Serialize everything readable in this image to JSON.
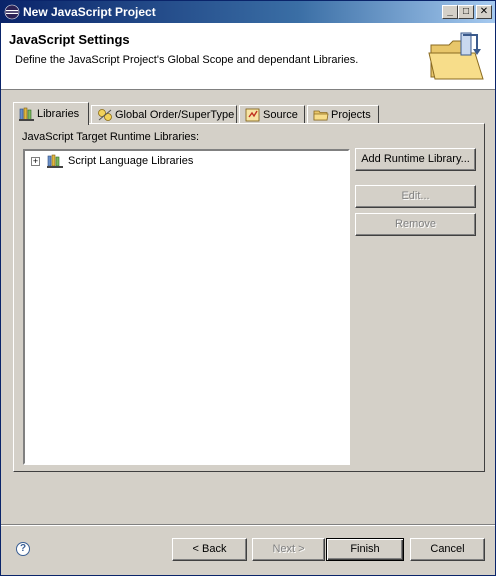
{
  "window": {
    "title": "New JavaScript Project",
    "controls": {
      "minimize": "_",
      "maximize": "□",
      "close": "✕"
    }
  },
  "banner": {
    "title": "JavaScript Settings",
    "description": "Define the JavaScript Project's Global Scope and dependant Libraries.",
    "icon": "wizard-folder-icon"
  },
  "tabs": [
    {
      "label": "Libraries",
      "icon": "libraries-icon",
      "active": true
    },
    {
      "label": "Global Order/SuperType",
      "icon": "order-icon",
      "active": false
    },
    {
      "label": "Source",
      "icon": "source-icon",
      "active": false
    },
    {
      "label": "Projects",
      "icon": "projects-icon",
      "active": false
    }
  ],
  "libraries": {
    "section_label": "JavaScript Target Runtime Libraries:",
    "tree_items": [
      {
        "label": "Script Language Libraries",
        "expander": "+"
      }
    ],
    "buttons": {
      "add": "Add Runtime Library...",
      "edit": "Edit...",
      "remove": "Remove"
    }
  },
  "footer": {
    "help": "?",
    "back": "< Back",
    "next": "Next >",
    "finish": "Finish",
    "cancel": "Cancel"
  },
  "colors": {
    "titlebar_start": "#0a246a",
    "titlebar_end": "#a6caf0",
    "dialog_bg": "#d4d0c8"
  }
}
